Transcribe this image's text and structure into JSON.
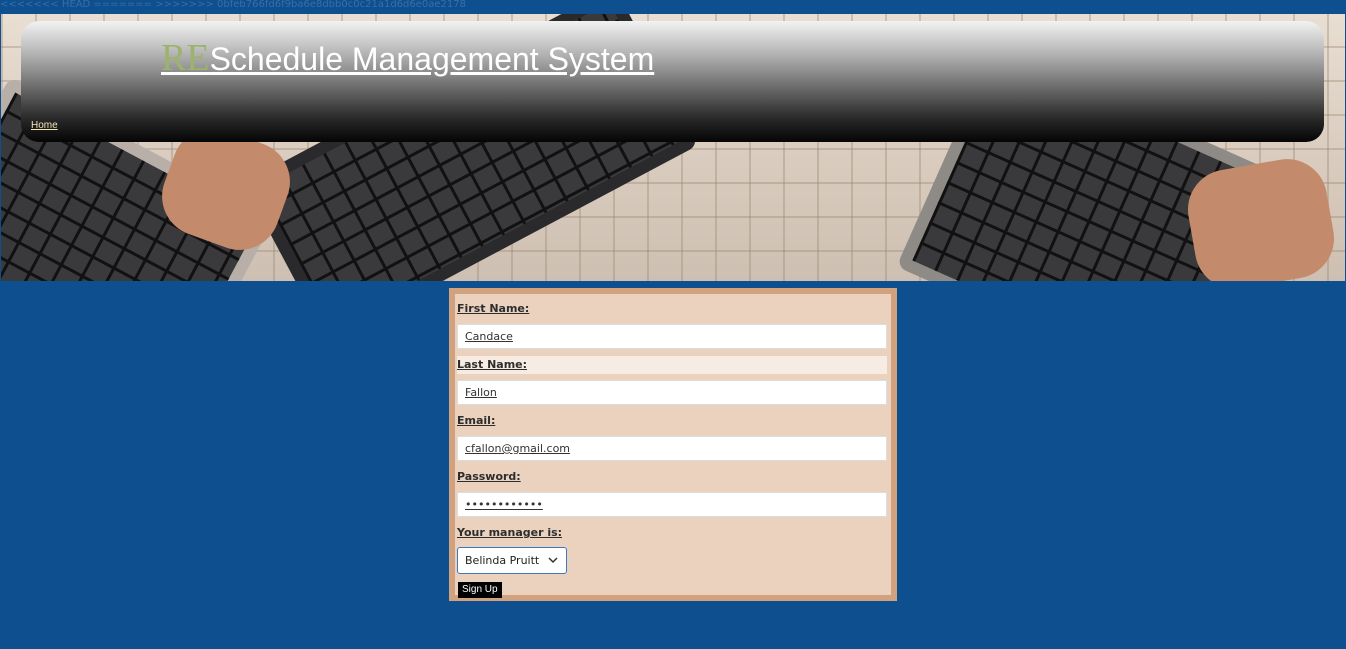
{
  "merge_marker": "<<<<<<< HEAD ======= >>>>>>> 0bfeb766fd6f9ba6e8dbb0c0c21a1d6d6e0ae2178",
  "header": {
    "title_prefix": "RE",
    "title_rest": "Schedule Management System",
    "nav": {
      "home_label": "Home"
    }
  },
  "form": {
    "first_name": {
      "label": "First Name:",
      "value": "Candace"
    },
    "last_name": {
      "label": "Last Name:",
      "value": "Fallon"
    },
    "email": {
      "label": "Email:",
      "value": "cfallon@gmail.com"
    },
    "password": {
      "label": "Password:",
      "value": "••••••••••••"
    },
    "manager": {
      "label": "Your manager is:",
      "selected": "Belinda Pruitt"
    },
    "submit_label": "Sign Up"
  },
  "colors": {
    "page_background": "#0e4f8f",
    "title_prefix": "#9bb36c",
    "form_border": "#d2a27f",
    "form_background": "#ead2bf"
  },
  "icons": {
    "select_chevron": "chevron-down-icon"
  }
}
